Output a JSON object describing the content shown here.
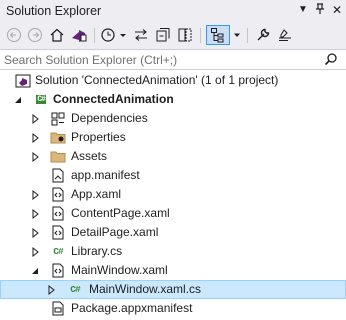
{
  "window": {
    "title": "Solution Explorer"
  },
  "search": {
    "placeholder": "Search Solution Explorer (Ctrl+;)"
  },
  "tree": {
    "solution": "Solution 'ConnectedAnimation' (1 of 1 project)",
    "project": "ConnectedAnimation",
    "project_badge": "C#",
    "items": [
      {
        "label": "Dependencies"
      },
      {
        "label": "Properties"
      },
      {
        "label": "Assets"
      },
      {
        "label": "app.manifest"
      },
      {
        "label": "App.xaml"
      },
      {
        "label": "ContentPage.xaml"
      },
      {
        "label": "DetailPage.xaml"
      },
      {
        "label": "Library.cs",
        "badge": "C#"
      },
      {
        "label": "MainWindow.xaml"
      },
      {
        "label": "MainWindow.xaml.cs",
        "badge": "C#"
      },
      {
        "label": "Package.appxmanifest"
      }
    ]
  },
  "colors": {
    "accent": "#007acc",
    "selection": "#cce8ff",
    "csharp": "#388a34",
    "folder": "#dcb67a"
  }
}
